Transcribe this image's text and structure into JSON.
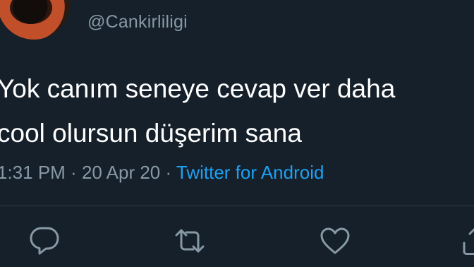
{
  "tweet": {
    "handle": "@Cankirliligi",
    "text_lines": [
      "Yok canım seneye cevap ver daha",
      "cool olursun düşerim sana"
    ],
    "time": "1:31 PM",
    "sep1": " · ",
    "date": "20 Apr 20",
    "sep2": " · ",
    "source": "Twitter for Android"
  },
  "actions": {
    "reply_icon": "reply-icon",
    "retweet_icon": "retweet-icon",
    "like_icon": "like-icon",
    "share_icon": "share-icon"
  },
  "colors": {
    "background": "#15202b",
    "text": "#ffffff",
    "muted": "#8899a6",
    "link": "#1da1f2"
  }
}
